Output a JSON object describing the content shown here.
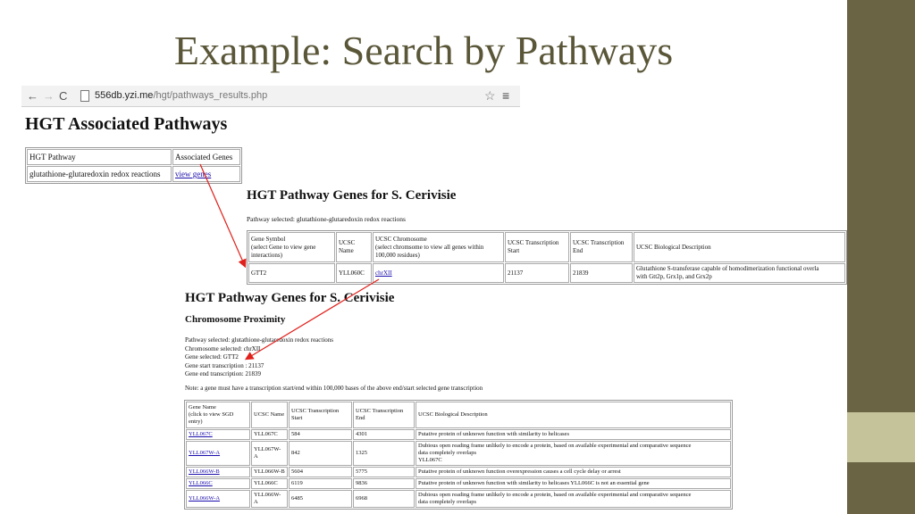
{
  "slide": {
    "title": "Example: Search by Pathways",
    "colors": {
      "bar": "#6b6444",
      "accent": "#c5c39a",
      "title": "#5a5638",
      "arrow": "#e0201b"
    }
  },
  "browser": {
    "back_icon": "back-arrow-icon",
    "url_host": "556db.yzi.me",
    "url_path": "/hgt/pathways_results.php"
  },
  "panel1": {
    "heading": "HGT Associated Pathways",
    "headers": [
      "HGT Pathway",
      "Associated Genes"
    ],
    "row": {
      "pathway": "glutathione-glutaredoxin redox reactions",
      "link": "view genes"
    }
  },
  "panel2": {
    "heading": "HGT Pathway Genes for S. Cerivisie",
    "pathway_selected": "Pathway selected: glutathione-glutaredoxin redox reactions",
    "headers": [
      "Gene Symbol",
      "(select Gene to view gene",
      "interactions)",
      "UCSC",
      "Name",
      "UCSC Chromosome",
      "(select chromsome to view all genes within",
      "100,000 residues)",
      "UCSC Transcription",
      "Start",
      "UCSC Transcription",
      "End",
      "UCSC Biological Description"
    ],
    "row": {
      "gene": "GTT2",
      "ucsc": "YLL060C",
      "chrom": "chrXII",
      "start": "21137",
      "end": "21839",
      "desc1": "Glutathione S-transferase capable of homodimerization functional overla",
      "desc2": "with Gtt2p, Grx1p, and Grx2p"
    }
  },
  "panel3": {
    "heading": "HGT Pathway Genes for S. Cerivisie",
    "subheading": "Chromosome Proximity",
    "info": [
      "Pathway selected: glutathione-glutaredoxin redox reactions",
      "Chromosome selected: chrXII",
      "Gene selected: GTT2",
      "Gene start transcription : 21137",
      "Gene end transcription: 21839"
    ],
    "note": "Note: a gene must have a transcription start/end within 100,000 bases of the above end/start selected gene transcription",
    "headers": [
      "Gene Name",
      "(click to view SGD",
      "entry)",
      "UCSC Name",
      "UCSC Transcription",
      "Start",
      "UCSC Transcription",
      "End",
      "UCSC Biological Description"
    ],
    "rows": [
      {
        "gene": "YLL067C",
        "ucsc": "YLL067C",
        "start": "584",
        "end": "4301",
        "desc": [
          "Putative protein of unknown function with similarity to helicases"
        ]
      },
      {
        "gene": "YLL067W-A",
        "ucsc": "YLL067W-A",
        "start": "842",
        "end": "1325",
        "desc": [
          "Dubious open reading frame unlikely to encode a protein, based on available experimental and comparative sequence",
          "data completely overlaps",
          "YLL067C"
        ]
      },
      {
        "gene": "YLL066W-B",
        "ucsc": "YLL066W-B",
        "start": "5604",
        "end": "5775",
        "desc": [
          "Putative protein of unknown function overexpression causes a cell cycle delay or arrest"
        ]
      },
      {
        "gene": "YLL066C",
        "ucsc": "YLL066C",
        "start": "6119",
        "end": "9836",
        "desc": [
          "Putative protein of unknown function with similarity to helicases YLL066C is not an essential gene"
        ]
      },
      {
        "gene": "YLL066W-A",
        "ucsc": "YLL066W-A",
        "start": "6485",
        "end": "6968",
        "desc": [
          "Dubious open reading frame unlikely to encode a protein, based on available experimental and comparative sequence",
          "data completely overlaps"
        ]
      }
    ]
  }
}
